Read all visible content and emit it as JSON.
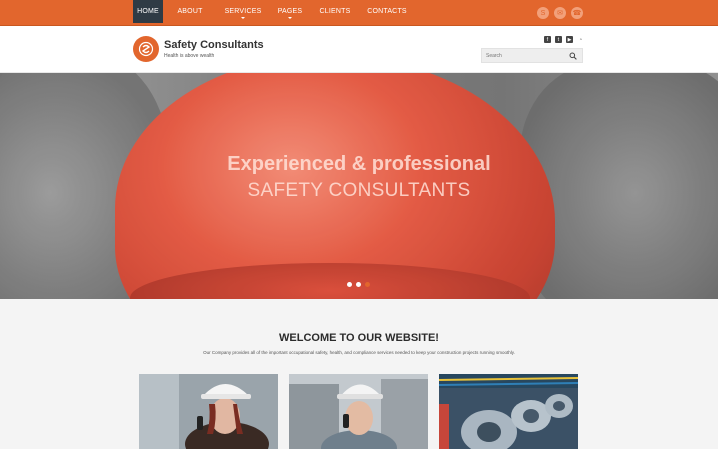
{
  "nav": {
    "items": [
      {
        "label": "HOME",
        "active": true,
        "has_dropdown": false
      },
      {
        "label": "ABOUT",
        "active": false,
        "has_dropdown": false
      },
      {
        "label": "SERVICES",
        "active": false,
        "has_dropdown": true
      },
      {
        "label": "PAGES",
        "active": false,
        "has_dropdown": true
      },
      {
        "label": "CLIENTS",
        "active": false,
        "has_dropdown": false
      },
      {
        "label": "CONTACTS",
        "active": false,
        "has_dropdown": false
      }
    ],
    "contact_icons": [
      "skype-icon",
      "mail-icon",
      "phone-icon"
    ]
  },
  "header": {
    "brand": "Safety Consultants",
    "slogan": "Health is above wealth",
    "social_icons": [
      "facebook-icon",
      "twitter-icon",
      "youtube-icon",
      "rss-icon"
    ],
    "search_placeholder": "Search"
  },
  "hero": {
    "line1": "Experienced & professional",
    "line2": "SAFETY CONSULTANTS",
    "slide_count": 3,
    "active_slide": 3
  },
  "content": {
    "welcome_title": "WELCOME TO OUR WEBSITE!",
    "intro_text": "Our Company provides all of the important occupational safety, health, and compliance services needed to keep your construction projects running smoothly."
  },
  "colors": {
    "accent": "#e2662d",
    "nav_active": "#2f3b45",
    "content_bg": "#f4f4f4"
  }
}
